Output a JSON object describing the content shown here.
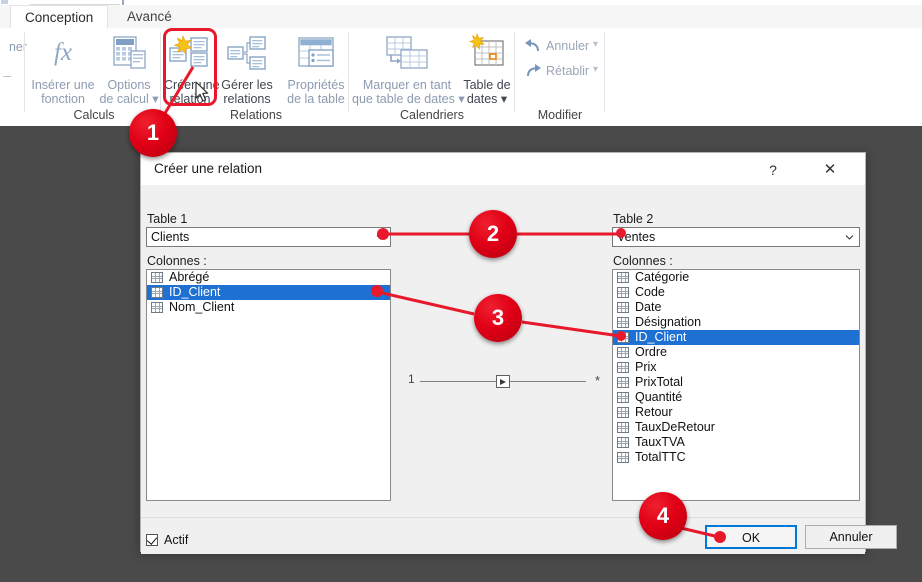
{
  "ribbon": {
    "tabs": [
      {
        "label": "Conception",
        "active": true
      },
      {
        "label": "Avancé",
        "active": false
      }
    ],
    "cut_off_left_label": "ner",
    "buttons": [
      {
        "name": "inserer-une-fonction",
        "line1": "Insérer une",
        "line2": "fonction",
        "icon": "fx-icon",
        "enabled": false
      },
      {
        "name": "options-de-calcul",
        "line1": "Options",
        "line2": "de calcul ▾",
        "icon": "calculator-icon",
        "enabled": false
      },
      {
        "name": "creer-une-relation",
        "line1": "Créer une",
        "line2": "relation",
        "icon": "create-relation-icon",
        "enabled": true
      },
      {
        "name": "gerer-les-relations",
        "line1": "Gérer les",
        "line2": "relations",
        "icon": "manage-relations-icon",
        "enabled": true
      },
      {
        "name": "proprietes-de-la-table",
        "line1": "Propriétés",
        "line2": "de la table",
        "icon": "table-properties-icon",
        "enabled": false
      },
      {
        "name": "marquer-en-tant-que-table-de-dates",
        "line1": "Marquer en tant",
        "line2": "que table de dates ▾",
        "icon": "mark-date-table-icon",
        "enabled": false
      },
      {
        "name": "table-de-dates",
        "line1": "Table de",
        "line2": "dates ▾",
        "icon": "date-table-icon",
        "enabled": true
      }
    ],
    "modifier": {
      "undo_label": "Annuler",
      "redo_label": "Rétablir",
      "undo_caret": "▾",
      "redo_caret": "▾"
    },
    "groups": [
      {
        "label": "Calculs"
      },
      {
        "label": "Relations"
      },
      {
        "label": "Calendriers"
      },
      {
        "label": "Modifier"
      }
    ]
  },
  "dialog": {
    "title": "Créer une relation",
    "help_glyph": "?",
    "close_glyph": "✕",
    "table1": {
      "label": "Table 1",
      "value": "Clients",
      "columns_label": "Colonnes :",
      "columns": [
        {
          "name": "Abrégé",
          "selected": false
        },
        {
          "name": "ID_Client",
          "selected": true
        },
        {
          "name": "Nom_Client",
          "selected": false
        }
      ]
    },
    "table2": {
      "label": "Table 2",
      "value": "Ventes",
      "columns_label": "Colonnes :",
      "columns": [
        {
          "name": "Catégorie",
          "selected": false
        },
        {
          "name": "Code",
          "selected": false
        },
        {
          "name": "Date",
          "selected": false
        },
        {
          "name": "Désignation",
          "selected": false
        },
        {
          "name": "ID_Client",
          "selected": true
        },
        {
          "name": "Ordre",
          "selected": false
        },
        {
          "name": "Prix",
          "selected": false
        },
        {
          "name": "PrixTotal",
          "selected": false
        },
        {
          "name": "Quantité",
          "selected": false
        },
        {
          "name": "Retour",
          "selected": false
        },
        {
          "name": "TauxDeRetour",
          "selected": false
        },
        {
          "name": "TauxTVA",
          "selected": false
        },
        {
          "name": "TotalTTC",
          "selected": false
        }
      ]
    },
    "cardinality": {
      "left": "1",
      "right": "*"
    },
    "active_checkbox": {
      "label": "Actif",
      "checked": true
    },
    "ok_label": "OK",
    "cancel_label": "Annuler"
  },
  "callouts": [
    {
      "number": "1"
    },
    {
      "number": "2"
    },
    {
      "number": "3"
    },
    {
      "number": "4"
    }
  ],
  "colors": {
    "accent_red": "#e8192c",
    "selection_blue": "#1e70d2",
    "focus_blue": "#0078d7",
    "desktop": "#4a4a4a"
  }
}
